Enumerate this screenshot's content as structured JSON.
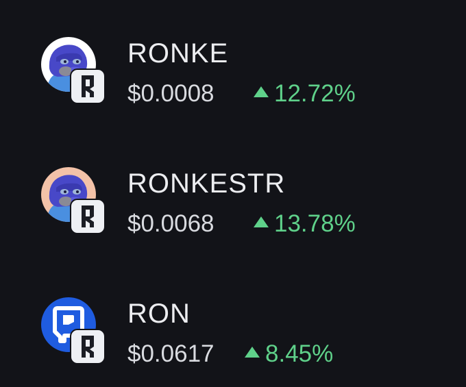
{
  "tokens": [
    {
      "name": "RONKE",
      "price": "$0.0008",
      "change": "12.72%",
      "avatar_icon": "ronke-gorilla-icon",
      "avatar_bg": "#ffffff",
      "badge_icon": "ronin-chain-icon"
    },
    {
      "name": "RONKESTR",
      "price": "$0.0068",
      "change": "13.78%",
      "avatar_icon": "ronkestr-gorilla-icon",
      "avatar_bg": "#f3c2a8",
      "badge_icon": "ronin-chain-icon"
    },
    {
      "name": "RON",
      "price": "$0.0617",
      "change": "8.45%",
      "avatar_icon": "ronin-logo-icon",
      "avatar_bg": "#1f5ce0",
      "badge_icon": "ronin-chain-icon"
    }
  ],
  "colors": {
    "background": "#121318",
    "positive": "#5fd18a",
    "text_primary": "#ecedf0"
  }
}
